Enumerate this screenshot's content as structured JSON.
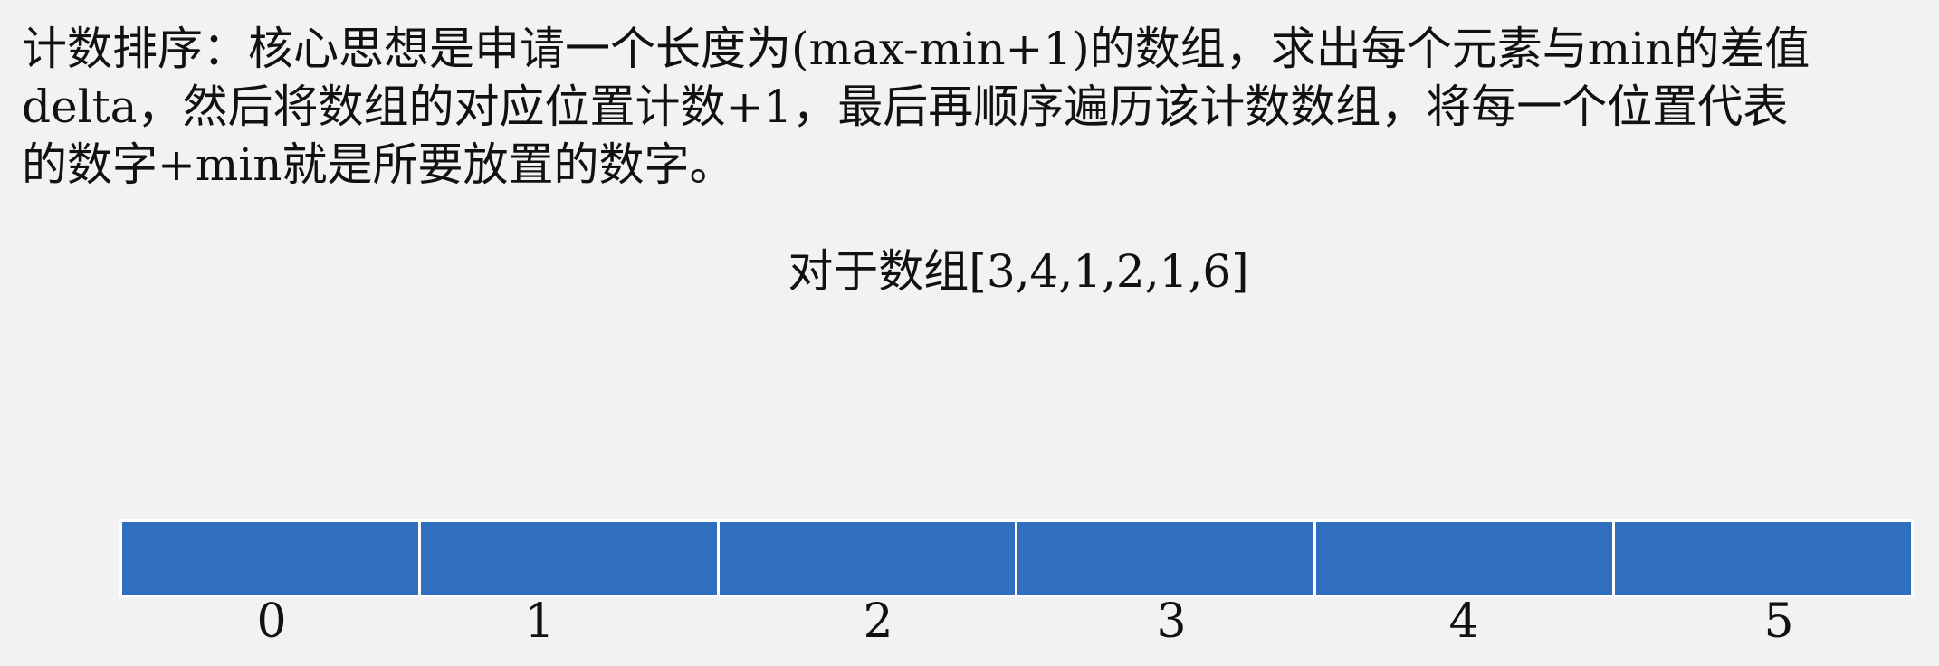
{
  "description_lines": [
    "计数排序：核心思想是申请一个长度为(max-min+1)的数组，求出每个元素与min的差值",
    "delta，然后将数组的对应位置计数+1，最后再顺序遍历该计数数组，将每一个位置代表",
    "的数字+min就是所要放置的数字。"
  ],
  "array_caption": "对于数组[3,4,1,2,1,6]",
  "count_array": {
    "fill_color": "#2f6fbd",
    "border_color": "#ffffff",
    "indices": [
      "0",
      "1",
      "2",
      "3",
      "4",
      "5"
    ]
  }
}
